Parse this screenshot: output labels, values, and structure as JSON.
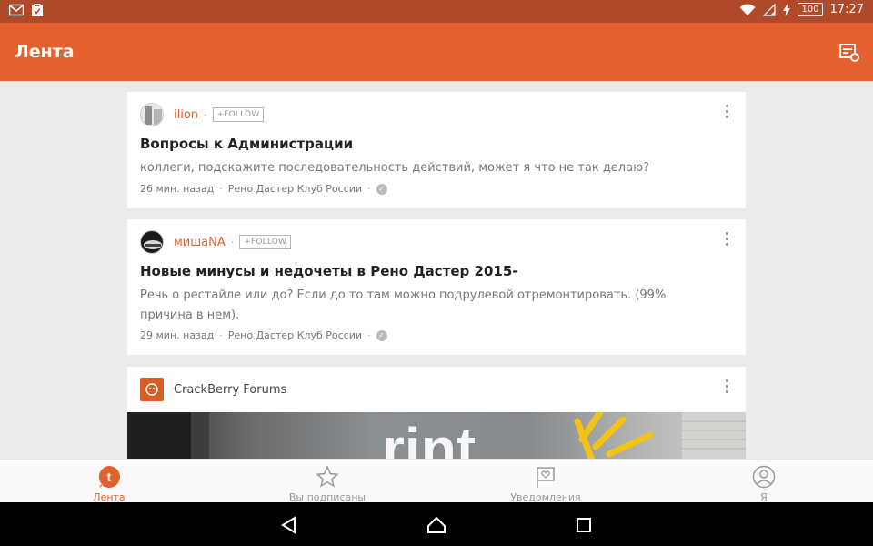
{
  "status_bar": {
    "time": "17:27",
    "battery": "100",
    "icons": [
      "gmail-icon",
      "clipboard-check-icon",
      "wifi-icon",
      "signal-icon",
      "charging-icon"
    ]
  },
  "app_bar": {
    "title": "Лента",
    "action_icon": "feed-settings-icon"
  },
  "feed": {
    "posts": [
      {
        "author": "ilion",
        "follow_label": "+FOLLOW",
        "title": "Вопросы к Администрации",
        "body": "коллеги, подскажите последовательность действий, может я что не так делаю?",
        "time": "26 мин. назад",
        "community": "Рено Дастер Клуб России"
      },
      {
        "author": "мишаNA",
        "follow_label": "+FOLLOW",
        "title": "Новые минусы и недочеты в Рено Дастер 2015-",
        "body": "Речь о рестайле или до? Если до то там можно подрулевой отремонтировать. (99% причина в нем).",
        "time": "29 мин. назад",
        "community": "Рено Дастер Клуб России"
      }
    ],
    "sponsored": {
      "name": "CrackBerry Forums"
    }
  },
  "bottom_nav": {
    "items": [
      {
        "label": "Лента",
        "icon": "tapatalk-icon"
      },
      {
        "label": "Вы подписаны",
        "icon": "star-icon"
      },
      {
        "label": "Уведомления",
        "icon": "notification-flag-icon"
      },
      {
        "label": "Я",
        "icon": "profile-icon"
      }
    ]
  },
  "colors": {
    "accent": "#e4602f",
    "status_bar": "#b1492b",
    "background": "#ebebeb"
  }
}
